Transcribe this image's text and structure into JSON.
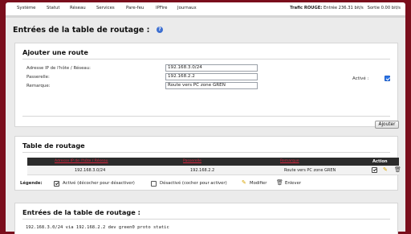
{
  "nav": {
    "items": [
      "Système",
      "Statut",
      "Réseau",
      "Services",
      "Pare-feu",
      "IPFire",
      "Journaux"
    ],
    "traffic_label": "Trafic ROUGE:",
    "traffic_in": "Entrée 236.31 bit/s",
    "traffic_out": "Sortie 0.00 bit/s"
  },
  "page": {
    "title": "Entrées de la table de routage :"
  },
  "add_route": {
    "title": "Ajouter une route",
    "ip_label": "Adresse IP de l'hôte / Réseau:",
    "ip_value": "192.168.3.0/24",
    "gateway_label": "Passerelle:",
    "gateway_value": "192.168.2.2",
    "remark_label": "Remarque:",
    "remark_value": "Route vers PC zone GREN",
    "active_label": "Activé :",
    "add_button": "Ajouter"
  },
  "routing_table": {
    "title": "Table de routage",
    "columns": [
      "Adresse IP de l'hôte / Réseau",
      "Passerelle",
      "Remarque",
      "Action"
    ],
    "rows": [
      {
        "ip": "192.168.3.0/24",
        "gateway": "192.168.2.2",
        "remark": "Route vers PC zone GREN"
      }
    ]
  },
  "legend": {
    "label": "Légende:",
    "active": "Activé (décocher pour désactiver)",
    "inactive": "Désactivé (cocher pour activer)",
    "edit": "Modifier",
    "remove": "Enlever"
  },
  "entries": {
    "title": "Entrées de la table de routage :",
    "line": "192.168.3.0/24 via 192.168.2.2 dev green0 proto static"
  },
  "colors": {
    "accent": "#7a0e1c",
    "header_red": "#d4243d",
    "checkbox_blue": "#2c75e8"
  }
}
